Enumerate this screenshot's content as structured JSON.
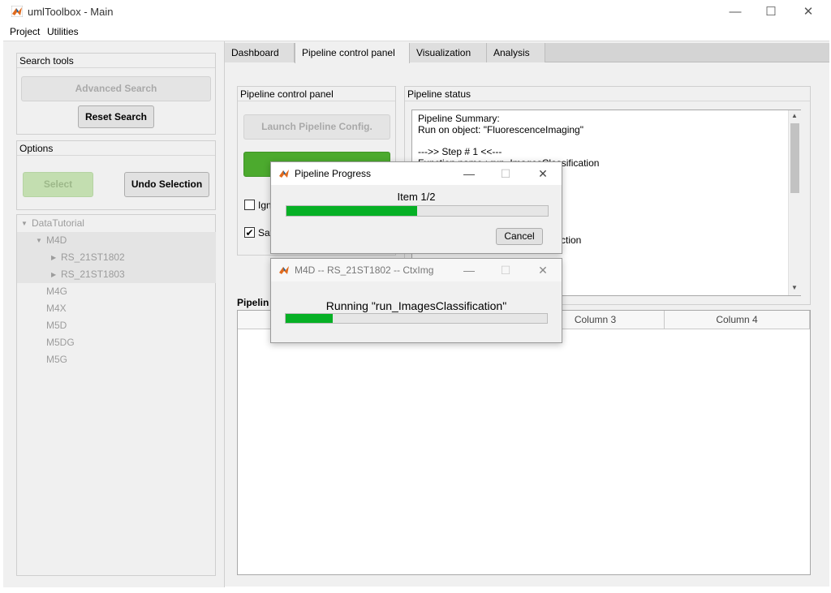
{
  "window": {
    "title": "umlToolbox - Main",
    "minimize": "—",
    "maximize": "☐",
    "close": "✕"
  },
  "menu": [
    "Project",
    "Utilities"
  ],
  "search_tools": {
    "title": "Search tools",
    "advanced_search": "Advanced Search",
    "reset_search": "Reset Search"
  },
  "options": {
    "title": "Options",
    "select": "Select",
    "undo_selection": "Undo Selection"
  },
  "tree": {
    "root": "DataTutorial",
    "m4d": "M4D",
    "child1": "RS_21ST1802",
    "child2": "RS_21ST1803",
    "others": [
      "M4G",
      "M4X",
      "M5D",
      "M5DG",
      "M5G"
    ]
  },
  "tabs": [
    "Dashboard",
    "Pipeline control panel",
    "Visualization",
    "Analysis"
  ],
  "pipeline_control": {
    "title": "Pipeline control panel",
    "launch_config": "Launch Pipeline Config.",
    "ignore_label": "Ign",
    "save_label": "Sav",
    "save_checked": true,
    "ignore_checked": false
  },
  "pipeline_status": {
    "title": "Pipeline status",
    "lines": [
      "Pipeline Summary:",
      "Run on object: \"FluorescenceImaging\"",
      "",
      "--->> Step # 1 <<---",
      "Function name : run_ImagesClassification"
    ],
    "partial_line": "ction"
  },
  "pipeline_table": {
    "title": "Pipelin",
    "columns": [
      "Column 3",
      "Column 4"
    ]
  },
  "progress_dialog": {
    "title": "Pipeline Progress",
    "label": "Item 1/2",
    "progress": 0.5,
    "cancel": "Cancel"
  },
  "task_dialog": {
    "title": "M4D -- RS_21ST1802 -- CtxImg",
    "label": "Running \"run_ImagesClassification\"",
    "progress": 0.18
  },
  "colors": {
    "progress_green": "#06b025",
    "run_button_green": "#4caa2e"
  }
}
